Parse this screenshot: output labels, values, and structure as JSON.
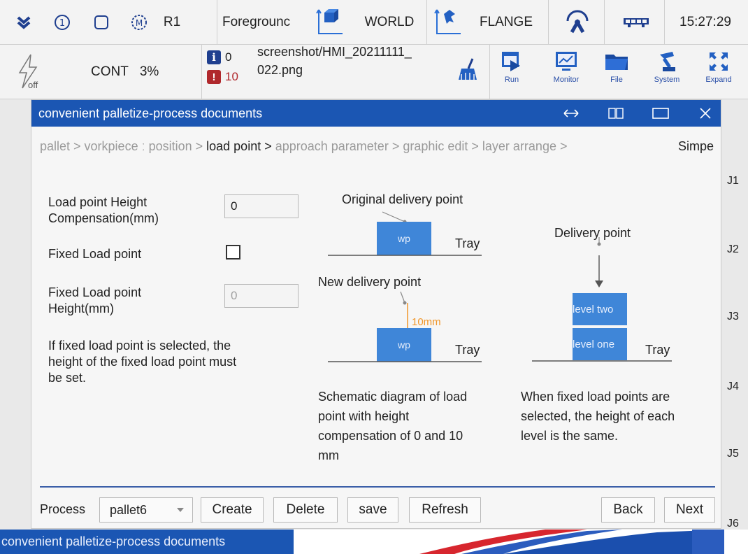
{
  "status_bar": {
    "robot": "R1",
    "mode": "Foregrounc",
    "coord_frame": "WORLD",
    "tool_frame": "FLANGE",
    "clock": "15:27:29"
  },
  "toolbar": {
    "power_state": "off",
    "run_mode": "CONT",
    "speed": "3%",
    "info_count": "0",
    "error_count": "10",
    "message_line1": "screenshot/HMI_20211111_",
    "message_line2": "022.png",
    "buttons": {
      "run": "Run",
      "monitor": "Monitor",
      "file": "File",
      "system": "System",
      "expand": "Expand"
    }
  },
  "dialog": {
    "title": "convenient palletize-process documents",
    "breadcrumb": {
      "before": "pallet > vorkpiece ː position > ",
      "current": "load point >",
      "after": " approach parameter > graphic edit > layer arrange >",
      "last": "Simpe"
    },
    "form": {
      "height_comp_label_1": "Load point Height",
      "height_comp_label_2": "Compensation(mm)",
      "height_comp_value": "0",
      "fixed_label": "Fixed Load point",
      "fixed_height_label_1": "Fixed Load point",
      "fixed_height_label_2": "Height(mm)",
      "fixed_height_placeholder": "0",
      "note_1": "If fixed load point is selected, the",
      "note_2": "height of the fixed load point must",
      "note_3": "be set."
    },
    "diagram_left": {
      "original_label": "Original delivery point",
      "new_label": "New delivery point",
      "wp": "wp",
      "tray": "Tray",
      "offset": "10mm",
      "caption_1": "Schematic diagram of load",
      "caption_2": "point with height",
      "caption_3": "compensation of 0 and 10",
      "caption_4": "mm"
    },
    "diagram_right": {
      "delivery_label": "Delivery point",
      "level_two": "level two",
      "level_one": "level one",
      "tray": "Tray",
      "caption_1": "When fixed load points are",
      "caption_2": "selected, the height of each",
      "caption_3": "level is the same."
    },
    "footer": {
      "process_label": "Process",
      "process_value": "pallet6",
      "create": "Create",
      "delete": "Delete",
      "save": "save",
      "refresh": "Refresh",
      "back": "Back",
      "next": "Next"
    }
  },
  "joints": [
    "J1",
    "J2",
    "J3",
    "J4",
    "J5",
    "J6"
  ],
  "taskbar": {
    "item": "convenient palletize-process documents"
  },
  "colors": {
    "title_blue": "#1b56b3",
    "box_blue": "#3f86d8",
    "offset_orange": "#f0962a",
    "error_red": "#b0282c"
  }
}
